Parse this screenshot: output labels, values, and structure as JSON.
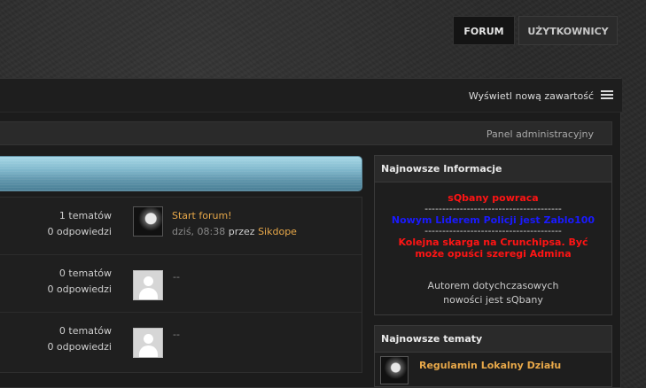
{
  "nav": {
    "tabs": [
      {
        "label": "FORUM",
        "active": true
      },
      {
        "label": "UŻYTKOWNICY",
        "active": false
      }
    ]
  },
  "toolbar": {
    "new_content_label": "Wyświetl nową zawartość",
    "list_icon": "list-icon"
  },
  "admin_panel_label": "Panel administracyjny",
  "forums": [
    {
      "topics": "1 tematów",
      "replies": "0 odpowiedzi",
      "last_post": {
        "title": "Start forum!",
        "time": "dziś, 08:38",
        "by": "przez",
        "author": "Sikdope"
      }
    },
    {
      "topics": "0 tematów",
      "replies": "0 odpowiedzi",
      "last_post_placeholder": "--"
    },
    {
      "topics": "0 tematów",
      "replies": "0 odpowiedzi",
      "last_post_placeholder": "--"
    }
  ],
  "sidebar": {
    "news": {
      "title": "Najnowsze Informacje",
      "line1": "sQbany powraca",
      "sep1": "---------------------------------------",
      "line2": "Nowym Liderem Policji jest Zablo100",
      "sep2": "---------------------------------------",
      "line3": "Kolejna skarga na Crunchipsa. Być może opuści szeregi Admina",
      "author_note": "Autorem dotychczasowych nowości jest sQbany"
    },
    "topics": {
      "title": "Najnowsze tematy",
      "items": [
        {
          "title": "Regulamin Lokalny Działu"
        }
      ]
    }
  },
  "colors": {
    "accent_orange": "#e8a849",
    "news_red": "#ff1414",
    "news_blue": "#1a1aff",
    "category_header": "#7fb7cb"
  }
}
